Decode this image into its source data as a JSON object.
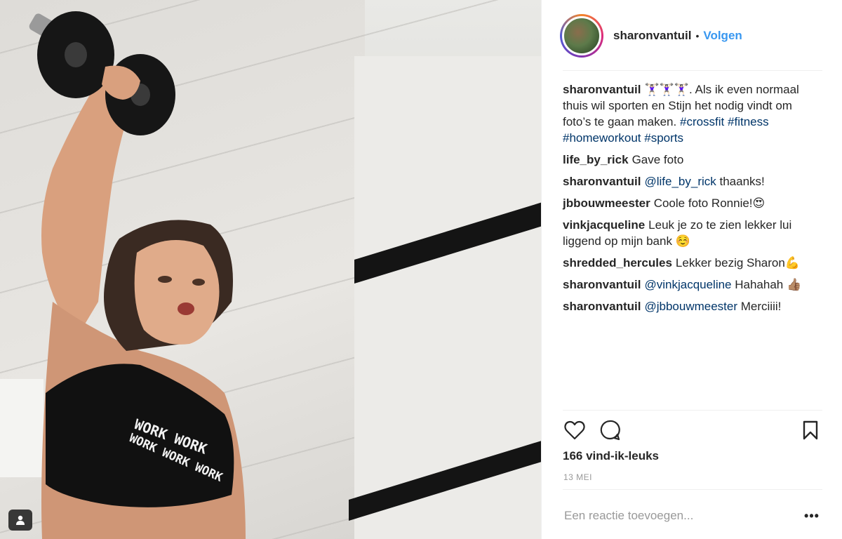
{
  "post": {
    "username": "sharonvantuil",
    "separator": "•",
    "follow_label": "Volgen",
    "photo_print_line1": "WORK WORK",
    "photo_print_line2": "WORK WORK WORK"
  },
  "comments": [
    {
      "user": "sharonvantuil",
      "text": "🏋🏻‍♀️🏋🏻‍♀️🏋🏻‍♀️. Als ik even normaal thuis wil sporten en Stijn het nodig vindt om foto’s te gaan maken.",
      "hashtags": [
        "#crossfit",
        "#fitness",
        "#homeworkout",
        "#sports"
      ]
    },
    {
      "user": "life_by_rick",
      "text": "Gave foto"
    },
    {
      "user": "sharonvantuil",
      "mention": "@life_by_rick",
      "text": "thaanks!"
    },
    {
      "user": "jbbouwmeester",
      "text": "Coole foto Ronnie!😍"
    },
    {
      "user": "vinkjacqueline",
      "text": "Leuk je zo te zien lekker lui liggend op mijn bank ☺️"
    },
    {
      "user": "shredded_hercules",
      "text": "Lekker bezig Sharon💪"
    },
    {
      "user": "sharonvantuil",
      "mention": "@vinkjacqueline",
      "text": "Hahahah 👍🏽"
    },
    {
      "user": "sharonvantuil",
      "mention": "@jbbouwmeester",
      "text": "Merciiii!"
    }
  ],
  "actions": {
    "like_icon": "heart-icon",
    "comment_icon": "comment-bubble-icon",
    "save_icon": "bookmark-icon"
  },
  "likes_text": "166 vind-ik-leuks",
  "date_text": "13 MEI",
  "add_comment": {
    "placeholder": "Een reactie toevoegen..."
  },
  "more_label": "•••",
  "colors": {
    "link": "#003569",
    "follow": "#3897f0",
    "text": "#262626",
    "muted": "#999999"
  }
}
